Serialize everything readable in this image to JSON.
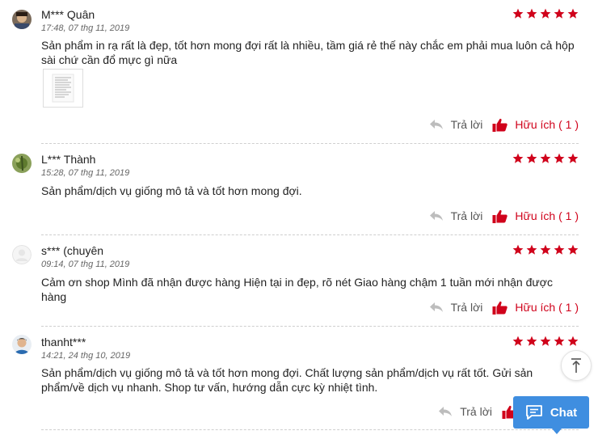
{
  "colors": {
    "accent": "#d0021b",
    "star": "#d0021b",
    "chat": "#3f8ee0"
  },
  "reviews": [
    {
      "name": "M*** Quân",
      "time": "17:48, 07 thg 11, 2019",
      "rating": 5,
      "text": "Sản phẩm in rạ rất là đẹp, tốt hơn mong đợi rất là nhiều, tầm giá rẻ thế này chắc em phải mua luôn cả hộp sài chứ cần đổ mực gì nữa",
      "reply_label": "Trả lời",
      "helpful_label": "Hữu ích ( 1 )"
    },
    {
      "name": "L*** Thành",
      "time": "15:28, 07 thg 11, 2019",
      "rating": 5,
      "text": "Sản phẩm/dịch vụ giống mô tả và tốt hơn mong đợi.",
      "reply_label": "Trả lời",
      "helpful_label": "Hữu ích ( 1 )"
    },
    {
      "name": "s*** (chuyên",
      "time": "09:14, 07 thg 11, 2019",
      "rating": 5,
      "text": "Cảm ơn shop Mình đã nhận được hàng Hiện tại in đẹp, rõ nét Giao hàng chậm 1 tuần mới nhận được hàng",
      "reply_label": "Trả lời",
      "helpful_label": "Hữu ích ( 1 )"
    },
    {
      "name": "thanht***",
      "time": "14:21, 24 thg 10, 2019",
      "rating": 5,
      "text": "Sản phẩm/dịch vụ giống mô tả và tốt hơn mong đợi. Chất lượng sản phẩm/dịch vụ rất tốt. Gửi sản phẩm/về dịch vụ nhanh. Shop tư vấn, hướng dẫn cực kỳ nhiệt tình.",
      "reply_label": "Trả lời",
      "helpful_label": ""
    }
  ],
  "chat": {
    "label": "Chat",
    "icon": "chat-bubble-icon"
  },
  "scroll_top": {
    "icon": "scroll-to-top-icon"
  }
}
